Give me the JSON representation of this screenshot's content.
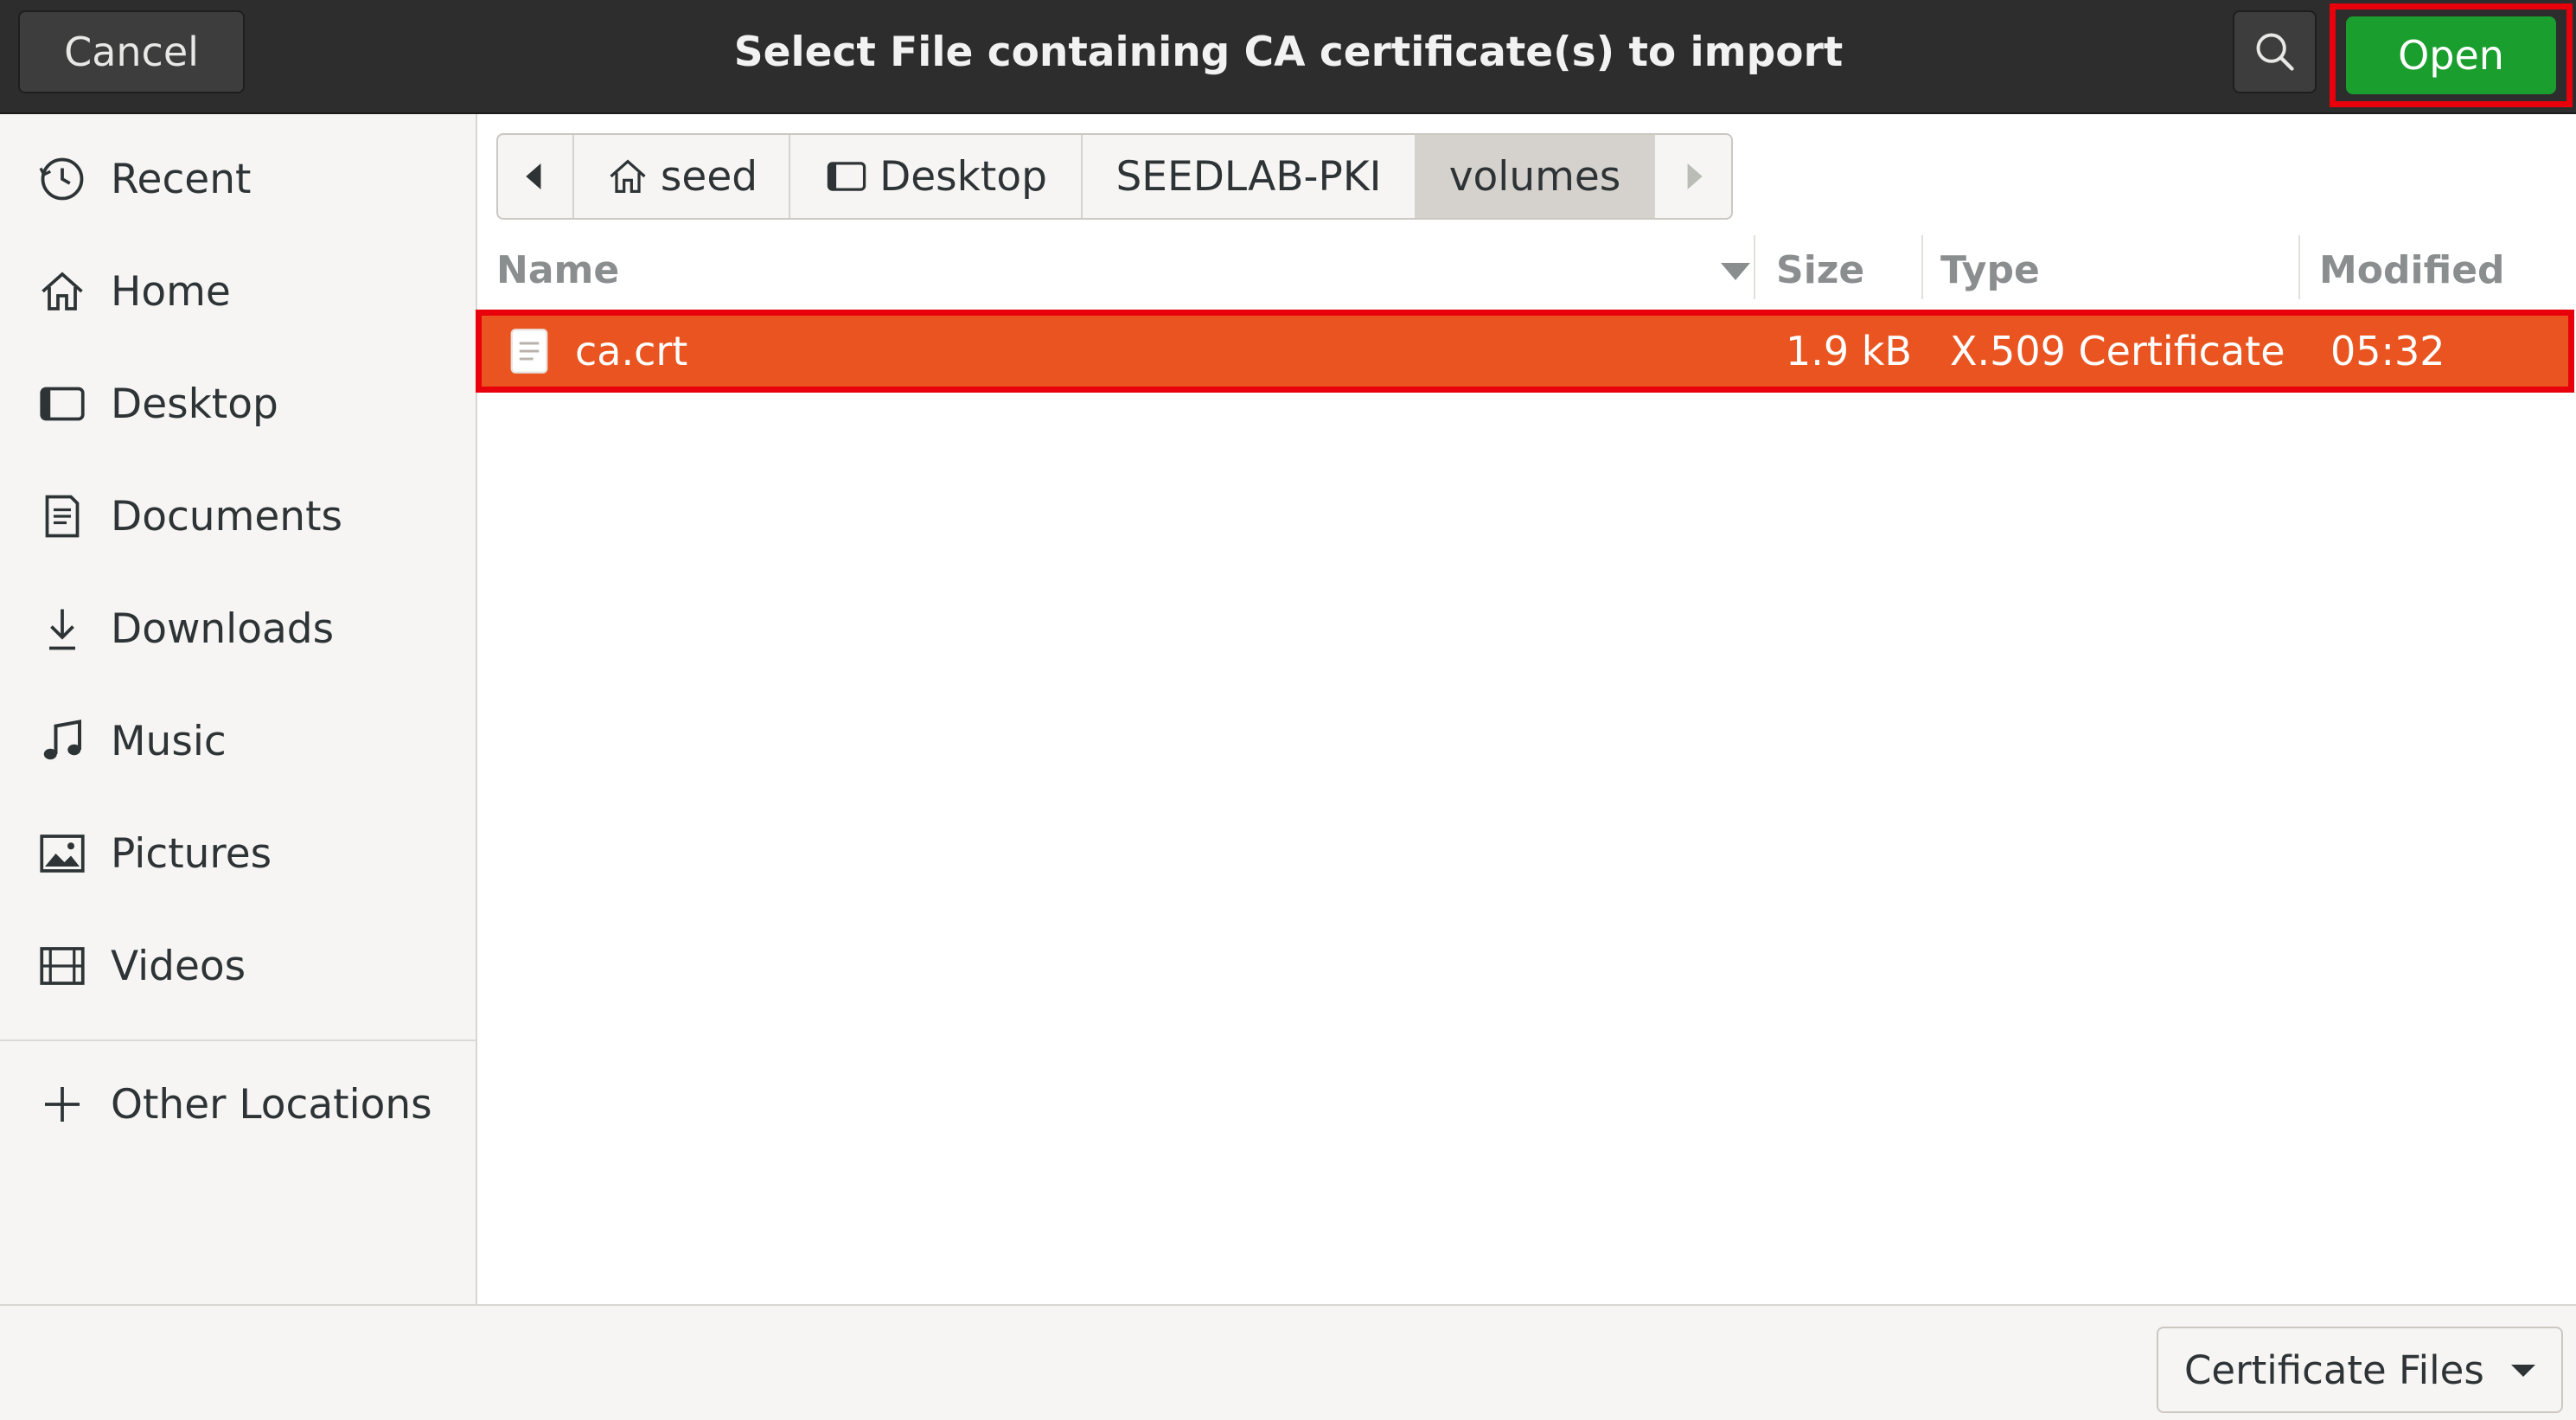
{
  "header": {
    "cancel_label": "Cancel",
    "title": "Select File containing CA certificate(s) to import",
    "search_icon": "search-icon",
    "open_label": "Open"
  },
  "sidebar": {
    "items": [
      {
        "label": "Recent",
        "icon": "clock-icon"
      },
      {
        "label": "Home",
        "icon": "home-icon"
      },
      {
        "label": "Desktop",
        "icon": "desktop-icon"
      },
      {
        "label": "Documents",
        "icon": "document-icon"
      },
      {
        "label": "Downloads",
        "icon": "download-icon"
      },
      {
        "label": "Music",
        "icon": "music-icon"
      },
      {
        "label": "Pictures",
        "icon": "picture-icon"
      },
      {
        "label": "Videos",
        "icon": "video-icon"
      }
    ],
    "other_locations": {
      "label": "Other Locations",
      "icon": "plus-icon"
    }
  },
  "pathbar": {
    "segments": [
      "seed",
      "Desktop",
      "SEEDLAB-PKI",
      "volumes"
    ],
    "active": "volumes"
  },
  "columns": {
    "name": "Name",
    "size": "Size",
    "type": "Type",
    "modified": "Modified"
  },
  "files": [
    {
      "name": "ca.crt",
      "size": "1.9 kB",
      "type": "X.509 Certificate",
      "modified": "05:32"
    }
  ],
  "footer": {
    "filter_label": "Certificate Files"
  },
  "colors": {
    "selection": "#e95420",
    "open_button": "#1a9e2e",
    "highlight_box": "#e8000a",
    "headerbar": "#2d2d2d"
  }
}
